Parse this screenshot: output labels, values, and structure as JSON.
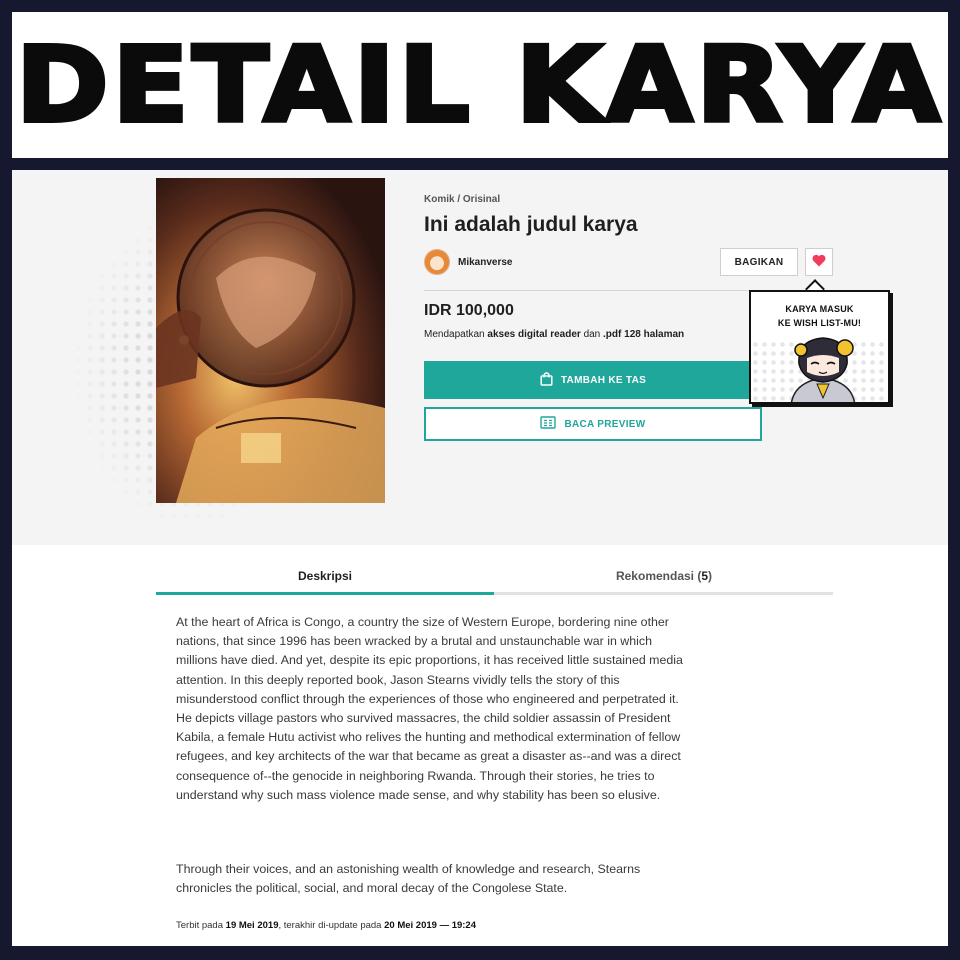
{
  "banner": {
    "title": "DETAIL KARYA"
  },
  "work": {
    "category": "Komik / Orisinal",
    "title": "Ini adalah judul karya",
    "author": "Mikanverse",
    "price": "IDR 100,000",
    "access": {
      "prefix": "Mendapatkan",
      "reader": "akses digital reader",
      "middle": "dan",
      "pages": ".pdf 128 halaman"
    }
  },
  "actions": {
    "share_label": "BAGIKAN",
    "add_to_bag_label": "TAMBAH KE TAS",
    "preview_label": "BACA PREVIEW"
  },
  "toast": {
    "line1": "KARYA MASUK",
    "line2": "KE WISH LIST-MU!"
  },
  "tabs": {
    "description_label": "Deskripsi",
    "recommendation_label": "Rekomendasi",
    "recommendation_open": "(",
    "recommendation_count": "5",
    "recommendation_close": ")"
  },
  "description": {
    "paragraph1": "At the heart of Africa is Congo, a country the size of Western Europe, bordering nine other nations, that since 1996 has been wracked by a brutal and unstaunchable war in which millions have died. And yet, despite its epic proportions, it has received little sustained media attention. In this deeply reported book, Jason Stearns vividly tells the story of this misunderstood conflict through the experiences of those who engineered and perpetrated it. He depicts village pastors who survived massacres, the child soldier assassin of President Kabila, a female Hutu activist who relives the hunting and methodical extermination of fellow refugees, and key architects of the war that became as great a disaster as--and was a direct consequence of--the genocide in neighboring Rwanda. Through their stories, he tries to understand why such mass violence made sense, and why stability has been so elusive.",
    "paragraph2": "Through their voices, and an astonishing wealth of knowledge and research, Stearns chronicles the political, social, and moral decay of the Congolese State."
  },
  "meta": {
    "published_prefix": "Terbit pada",
    "published_date": "19 Mei 2019",
    "updated_prefix": ", terakhir di-update pada",
    "updated_date": "20 Mei 2019 — 19:24"
  },
  "colors": {
    "accent": "#1fa79b",
    "heart": "#ef3e5c",
    "frame": "#161830"
  },
  "icons": {
    "wishlist": "heart-icon",
    "bag": "shopping-bag-icon",
    "preview": "book-preview-icon"
  }
}
